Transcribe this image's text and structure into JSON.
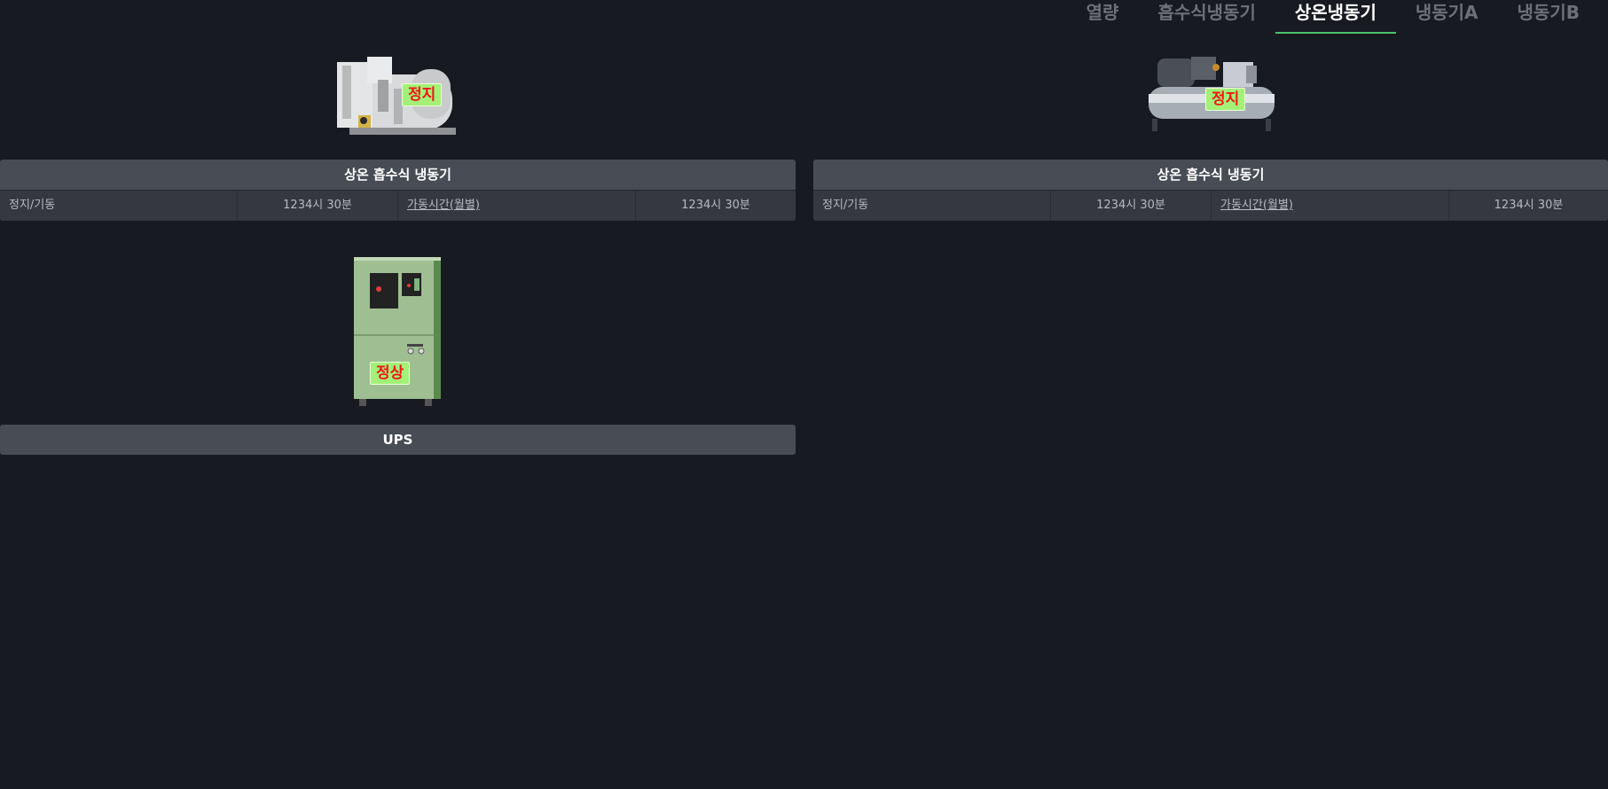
{
  "tabs": [
    {
      "label": "열량",
      "active": false,
      "partial": true
    },
    {
      "label": "흡수식냉동기",
      "active": false
    },
    {
      "label": "상온냉동기",
      "active": true
    },
    {
      "label": "냉동기A",
      "active": false
    },
    {
      "label": "냉동기B",
      "active": false
    }
  ],
  "cards": {
    "absorption_1": {
      "status": "정지",
      "title": "상온 흡수식 냉동기",
      "row": {
        "label": "정지/기동",
        "value1": "1234시 30분",
        "link": "가동시간(월별)",
        "value2": "1234시 30분"
      }
    },
    "absorption_2": {
      "status": "정지",
      "title": "상온 흡수식 냉동기",
      "row": {
        "label": "정지/기동",
        "value1": "1234시 30분",
        "link": "가동시간(월별)",
        "value2": "1234시 30분"
      }
    },
    "ups": {
      "status": "정상",
      "title": "UPS"
    }
  },
  "colors": {
    "background": "#181a21",
    "tab_active_underline": "#4cc26a",
    "badge_bg": "#a4f078",
    "badge_text": "#f01616"
  }
}
